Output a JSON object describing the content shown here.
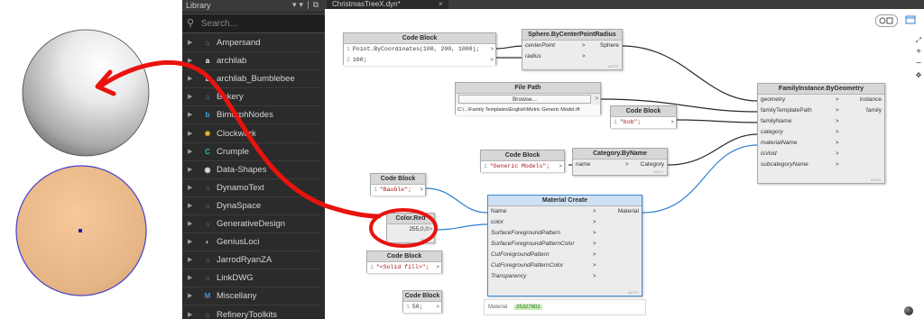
{
  "library": {
    "title": "Library",
    "search_placeholder": "Search...",
    "items": [
      {
        "label": "Ampersand",
        "icon": "ampersand-icon",
        "icon_glyph": "⌂",
        "color": "#4a8fd4"
      },
      {
        "label": "archilab",
        "icon": "archilab-icon",
        "icon_glyph": "a",
        "color": "#ffffff"
      },
      {
        "label": "archilab_Bumblebee",
        "icon": "bumblebee-icon",
        "icon_glyph": "a",
        "color": "#ffffff"
      },
      {
        "label": "Bakery",
        "icon": "bakery-icon",
        "icon_glyph": "⌂",
        "color": "#4a8fd4"
      },
      {
        "label": "BimorphNodes",
        "icon": "bimorph-icon",
        "icon_glyph": "b",
        "color": "#3aa0e8"
      },
      {
        "label": "Clockwork",
        "icon": "clockwork-icon",
        "icon_glyph": "✹",
        "color": "#e8b82a"
      },
      {
        "label": "Crumple",
        "icon": "crumple-icon",
        "icon_glyph": "C",
        "color": "#3ab6c8"
      },
      {
        "label": "Data-Shapes",
        "icon": "data-shapes-icon",
        "icon_glyph": "◉",
        "color": "#dddddd"
      },
      {
        "label": "DynamoText",
        "icon": "dynamotext-icon",
        "icon_glyph": "⌂",
        "color": "#4a8fd4"
      },
      {
        "label": "DynaSpace",
        "icon": "dynaspace-icon",
        "icon_glyph": "⌂",
        "color": "#4a8fd4"
      },
      {
        "label": "GenerativeDesign",
        "icon": "generativedesign-icon",
        "icon_glyph": "⌂",
        "color": "#4a8fd4"
      },
      {
        "label": "GeniusLoci",
        "icon": "geniusloci-icon",
        "icon_glyph": "◐",
        "color": "#bbbbbb"
      },
      {
        "label": "JarrodRyanZA",
        "icon": "jarrod-icon",
        "icon_glyph": "⌂",
        "color": "#4a8fd4"
      },
      {
        "label": "LinkDWG",
        "icon": "linkdwg-icon",
        "icon_glyph": "⌂",
        "color": "#4a8fd4"
      },
      {
        "label": "Miscellany",
        "icon": "miscellany-icon",
        "icon_glyph": "M",
        "color": "#4a8fd4"
      },
      {
        "label": "RefineryToolkits",
        "icon": "refinery-icon",
        "icon_glyph": "⌂",
        "color": "#4a8fd4"
      }
    ]
  },
  "workspace": {
    "tab_title": "ChristmasTreeX.dyn*",
    "tab_close": "×"
  },
  "nodes": {
    "cb1": {
      "title": "Code Block",
      "line1_no": "1",
      "line1": "Point.ByCoordinates(100, 200, 1000);",
      "line2_no": "2",
      "line2": "100;",
      "out_chev": ">"
    },
    "sphere": {
      "title": "Sphere.ByCenterPointRadius",
      "in1": "centerPoint",
      "in2": "radius",
      "out": "Sphere",
      "auto": "AUTO"
    },
    "filepath": {
      "title": "File Path",
      "button": "Browse...",
      "path": "C:\\...\\Family Templates\\English\\Metric Generic Model.rft"
    },
    "cb_bob": {
      "title": "Code Block",
      "line_no": "1",
      "line": "\"bob\";"
    },
    "famgeom": {
      "title": "FamilyInstance.ByGeometry",
      "in": [
        "geometry",
        "familyTemplatePath",
        "familyName",
        "category",
        "materialName",
        "isVoid",
        "subcategoryName"
      ],
      "out": [
        "instance",
        "family"
      ],
      "auto": "AUTO"
    },
    "cb_generic": {
      "title": "Code Block",
      "line_no": "1",
      "line": "\"Generic Models\";"
    },
    "catbyname": {
      "title": "Category.ByName",
      "in": "name",
      "out": "Category",
      "auto": "AUTO"
    },
    "cb_bauble": {
      "title": "Code Block",
      "line_no": "1",
      "line": "\"Bauble\";"
    },
    "colorred": {
      "title": "Color.Red",
      "value": "255,0,0",
      "auto": "AUTO"
    },
    "matcreate": {
      "title": "Material Create",
      "in": [
        "Name",
        "color",
        "SurfaceForegroundPattern",
        "SurfaceForegroundPatternColor",
        "CutForegroundPattern",
        "CutForegroundPatternColor",
        "Transparency"
      ],
      "out": "Material",
      "auto": "AUTO"
    },
    "cb_solid": {
      "title": "Code Block",
      "line_no": "1",
      "line": "\"<Solid fill>\";"
    },
    "cb_50": {
      "title": "Code Block",
      "line_no": "1",
      "line": "50;"
    },
    "preview": {
      "label": "Material",
      "value": "25327602"
    }
  },
  "colors": {
    "library_bg": "#2b2b2b",
    "annotation_red": "#e8130e",
    "wire_blue": "#2b7fd0",
    "node_header": "#d7d7d7"
  }
}
